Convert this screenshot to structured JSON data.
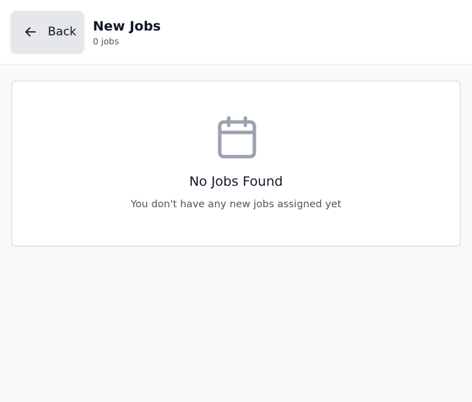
{
  "header": {
    "back_label": "Back",
    "back_icon": "arrow-left-icon",
    "title": "New Jobs",
    "count_text": "0 jobs"
  },
  "empty_state": {
    "icon": "calendar-icon",
    "title": "No Jobs Found",
    "message": "You don't have any new jobs assigned yet"
  },
  "colors": {
    "background": "#f8f9fb",
    "card": "#ffffff",
    "button": "#e5e7eb",
    "icon": "#9ca3af",
    "text": "#111827",
    "muted": "#4b5563"
  }
}
